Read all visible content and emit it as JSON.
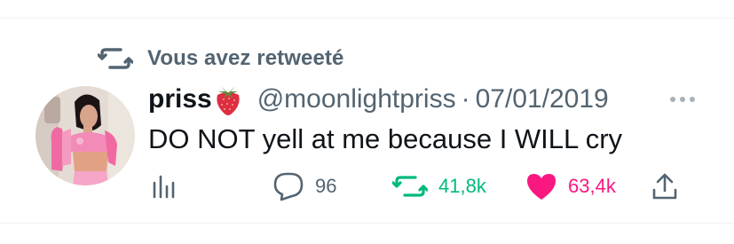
{
  "retweet_context": {
    "label": "Vous avez retweeté",
    "icon": "retweet-icon"
  },
  "tweet": {
    "author": {
      "display_name": "priss",
      "emoji": "strawberry",
      "handle": "@moonlightpriss",
      "avatar": "profile-photo"
    },
    "separator": "·",
    "date": "07/01/2019",
    "text": "DO NOT yell at me because I WILL cry",
    "metrics": {
      "reply_count": "96",
      "retweet_count": "41,8k",
      "like_count": "63,4k"
    }
  },
  "colors": {
    "text_primary": "#0f1419",
    "text_secondary": "#536471",
    "retweet_green": "#00ba7c",
    "like_pink": "#f91880",
    "divider": "#eff3f4"
  },
  "icons": [
    "retweet-icon",
    "more-icon",
    "analytics-icon",
    "reply-icon",
    "retweeted-icon",
    "liked-heart-icon",
    "share-icon"
  ]
}
